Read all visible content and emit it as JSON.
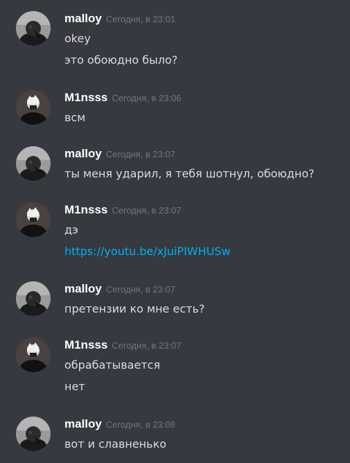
{
  "users": {
    "malloy": "malloy",
    "m1nsss": "M1nsss"
  },
  "messages": [
    {
      "author": "malloy",
      "avatar": "malloy-avatar",
      "timestamp": "Сегодня, в 23:01",
      "lines": [
        "okey",
        "это обоюдно было?"
      ]
    },
    {
      "author": "M1nsss",
      "avatar": "m1nsss-avatar",
      "timestamp": "Сегодня, в 23:06",
      "lines": [
        "всм"
      ]
    },
    {
      "author": "malloy",
      "avatar": "malloy-avatar",
      "timestamp": "Сегодня, в 23:07",
      "lines": [
        "ты меня ударил, я тебя шотнул, обоюдно?"
      ]
    },
    {
      "author": "M1nsss",
      "avatar": "m1nsss-avatar",
      "timestamp": "Сегодня, в 23:07",
      "lines": [
        "дэ",
        "https://youtu.be/xJuiPIWHUSw"
      ]
    },
    {
      "author": "malloy",
      "avatar": "malloy-avatar",
      "timestamp": "Сегодня, в 23:07",
      "lines": [
        "претензии ко мне есть?"
      ]
    },
    {
      "author": "M1nsss",
      "avatar": "m1nsss-avatar",
      "timestamp": "Сегодня, в 23:07",
      "lines": [
        "обрабатывается",
        "нет"
      ]
    },
    {
      "author": "malloy",
      "avatar": "malloy-avatar",
      "timestamp": "Сегодня, в 23:08",
      "lines": [
        "вот и славненько"
      ]
    }
  ],
  "colors": {
    "background": "#36393f",
    "author": "#ffffff",
    "timestamp": "#72767d",
    "text": "#dcddde",
    "link": "#00b0f4"
  }
}
